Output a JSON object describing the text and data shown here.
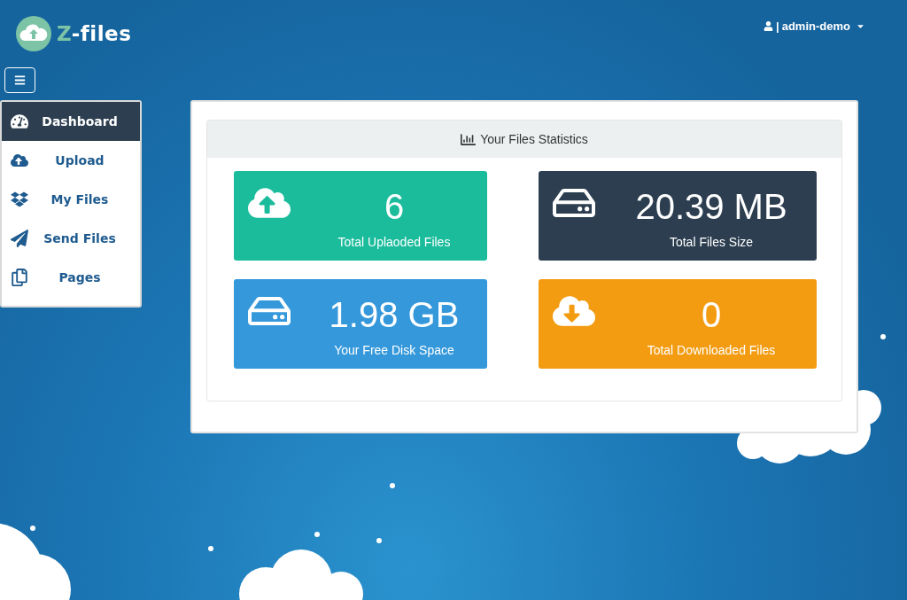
{
  "logo": {
    "accent": "Z",
    "text": "-files"
  },
  "user_menu": {
    "separator": "|",
    "label": "admin-demo"
  },
  "sidebar": {
    "items": [
      {
        "label": "Dashboard",
        "selected": true
      },
      {
        "label": "Upload",
        "selected": false
      },
      {
        "label": "My Files",
        "selected": false
      },
      {
        "label": "Send Files",
        "selected": false
      },
      {
        "label": "Pages",
        "selected": false
      }
    ]
  },
  "stats": {
    "title": "Your Files Statistics",
    "tiles": [
      {
        "kind": "upload",
        "value": "6",
        "label": "Total Uplaoded Files",
        "color": "#1abc9c"
      },
      {
        "kind": "disk",
        "value": "20.39 MB",
        "label": "Total Files Size",
        "color": "#2c3e50"
      },
      {
        "kind": "disk",
        "value": "1.98 GB",
        "label": "Your Free Disk Space",
        "color": "#3498db"
      },
      {
        "kind": "download",
        "value": "0",
        "label": "Total Downloaded Files",
        "color": "#f39c12"
      }
    ]
  }
}
